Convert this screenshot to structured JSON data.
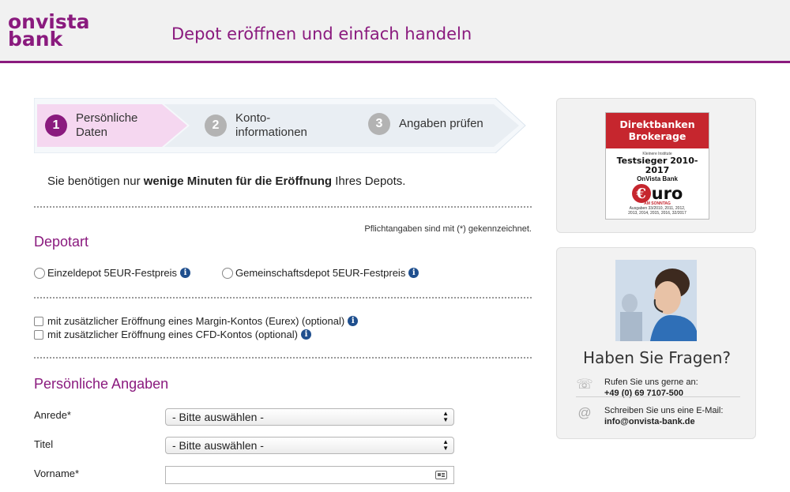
{
  "header": {
    "logo_line1": "onvista",
    "logo_line2": "bank",
    "title": "Depot eröffnen und einfach handeln"
  },
  "steps": [
    {
      "number": "1",
      "label_line1": "Persönliche",
      "label_line2": "Daten",
      "active": true
    },
    {
      "number": "2",
      "label_line1": "Konto-",
      "label_line2": "informationen",
      "active": false
    },
    {
      "number": "3",
      "label_line1": "Angaben prüfen",
      "label_line2": "",
      "active": false
    }
  ],
  "intro": {
    "before": "Sie benötigen nur ",
    "bold": "wenige Minuten für die Eröffnung",
    "after": " Ihres Depots."
  },
  "required_note": "Pflichtangaben sind mit (*) gekennzeichnet.",
  "depotart": {
    "title": "Depotart",
    "options": [
      {
        "label": "Einzeldepot 5EUR-Festpreis",
        "selected": false
      },
      {
        "label": "Gemeinschaftsdepot 5EUR-Festpreis",
        "selected": false
      }
    ]
  },
  "extras": [
    {
      "label": "mit zusätzlicher Eröffnung eines Margin-Kontos (Eurex) (optional)",
      "checked": false
    },
    {
      "label": "mit zusätzlicher Eröffnung eines CFD-Kontos (optional)",
      "checked": false
    }
  ],
  "personal": {
    "title": "Persönliche Angaben",
    "anrede_label": "Anrede*",
    "anrede_value": "- Bitte auswählen -",
    "titel_label": "Titel",
    "titel_value": "- Bitte auswählen -",
    "vorname_label": "Vorname*",
    "vorname_value": ""
  },
  "badge": {
    "line1": "Direktbanken",
    "line2": "Brokerage",
    "small": "Kleinere Institute",
    "winner": "Testsieger 2010-2017",
    "bank": "OnVista Bank",
    "logo_e": "€",
    "logo_rest": "uro",
    "logo_sub": "AM SONNTAG",
    "years_line1": "Ausgaben 33/2010, 2011, 2012,",
    "years_line2": "2013, 2014, 2015, 2016, 32/2017"
  },
  "help": {
    "title": "Haben Sie Fragen?",
    "phone_label": "Rufen Sie uns gerne an:",
    "phone": "+49 (0) 69 7107-500",
    "email_label": "Schreiben Sie uns eine E-Mail:",
    "email": "info@onvista-bank.de",
    "phone_icon": "phone-icon",
    "email_icon": "at-icon"
  },
  "colors": {
    "brand": "#8a1a7e",
    "active_step_bg": "#f5d7f0",
    "inactive_step_bg": "#e9eef3",
    "inactive_circle": "#b3b3b3",
    "info_icon": "#1f4f8e"
  }
}
